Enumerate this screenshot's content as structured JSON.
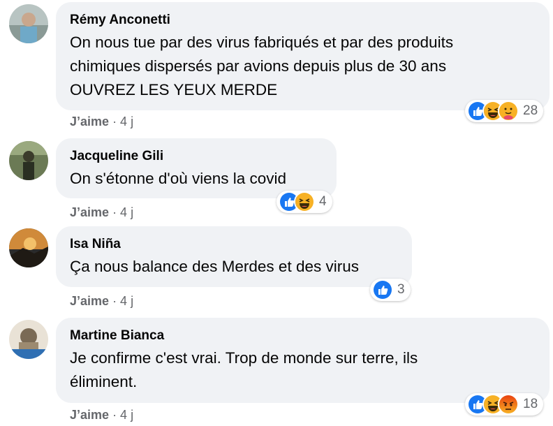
{
  "comments": [
    {
      "author": "Rémy Anconetti",
      "text": "On nous tue par des virus fabriqués et par des produits\nchimiques dispersés par avions depuis plus de 30 ans\nOUVREZ LES YEUX MERDE",
      "like_label": "J’aime",
      "time": "· 4 j",
      "reaction_icons": [
        "like-icon",
        "haha-icon",
        "care-icon"
      ],
      "reaction_count": "28"
    },
    {
      "author": "Jacqueline Gili",
      "text": "On s'étonne d'où viens la covid",
      "like_label": "J’aime",
      "time": "· 4 j",
      "reaction_icons": [
        "like-icon",
        "haha-icon"
      ],
      "reaction_count": "4"
    },
    {
      "author": "Isa Niña",
      "text": "Ça nous balance des Merdes et des virus",
      "like_label": "J’aime",
      "time": "· 4 j",
      "reaction_icons": [
        "like-icon"
      ],
      "reaction_count": "3"
    },
    {
      "author": "Martine Bianca",
      "text": "Je confirme c'est vrai. Trop de monde sur terre, ils\néliminent.",
      "like_label": "J’aime",
      "time": "· 4 j",
      "reaction_icons": [
        "like-icon",
        "haha-icon",
        "angry-icon"
      ],
      "reaction_count": "18"
    }
  ],
  "colors": {
    "bubble": "#f0f2f5",
    "like_blue": "#1877f2",
    "haha_yellow": "#f7b125",
    "angry_orange": "#e9710f",
    "meta_gray": "#65676b"
  }
}
